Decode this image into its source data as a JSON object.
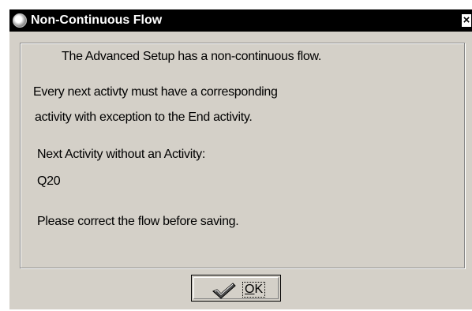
{
  "window": {
    "title": "Non-Continuous Flow",
    "close_glyph": "×"
  },
  "message": {
    "line1": "The Advanced Setup has a non-continuous flow.",
    "line2": "Every next activty must have a corresponding",
    "line3": "activity with exception to the End activity.",
    "line4": "Next Activity without an Activity:",
    "line5": "Q20",
    "line6": "Please correct the flow before saving."
  },
  "button": {
    "ok_mnemonic": "O",
    "ok_rest": "K",
    "ok_icon": "checkmark-icon"
  },
  "colors": {
    "titlebar_bg": "#000000",
    "titlebar_text": "#ffffff",
    "dialog_bg": "#d4d0c8"
  }
}
